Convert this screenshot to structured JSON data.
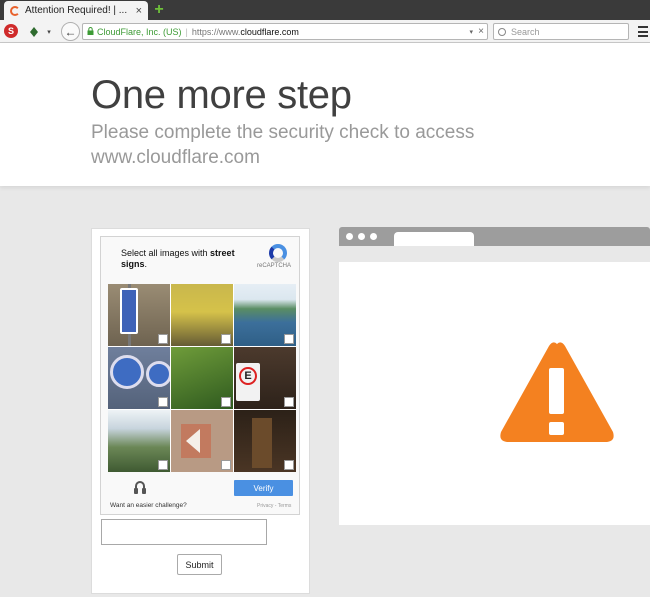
{
  "browser": {
    "tab_title": "Attention Required! | ...",
    "tab_close": "×",
    "new_tab": "+",
    "url_identity": "CloudFlare, Inc. (US)",
    "url_scheme": "https://www.",
    "url_host": "cloudflare.com",
    "search_placeholder": "Search",
    "ext_label": "S",
    "back_glyph": "←",
    "dropdown_glyph": "▾",
    "clear_glyph": "×"
  },
  "header": {
    "title": "One more step",
    "subtitle": "Please complete the security check to access www.cloudflare.com"
  },
  "captcha": {
    "instruction_prefix": "Select all images with ",
    "instruction_bold": "street signs",
    "instruction_suffix": ".",
    "logo_text": "reCAPTCHA",
    "tile_subjects": [
      "street sign",
      "yellow post",
      "lake",
      "blue signs",
      "foliage",
      "parking sign",
      "hillside",
      "arrow sign",
      "doorway"
    ],
    "verify_label": "Verify",
    "easier_label": "Want an easier challenge?",
    "privacy_label": "Privacy - Terms",
    "submit_label": "Submit",
    "answer_value": ""
  },
  "colors": {
    "warning": "#f48120",
    "verify_button": "#4a90e2",
    "page_background": "#e8e8e8"
  },
  "icons": {
    "warning": "warning-triangle-icon",
    "audio": "headphones-icon",
    "lock": "lock-icon",
    "search": "search-icon",
    "menu": "hamburger-menu-icon"
  }
}
